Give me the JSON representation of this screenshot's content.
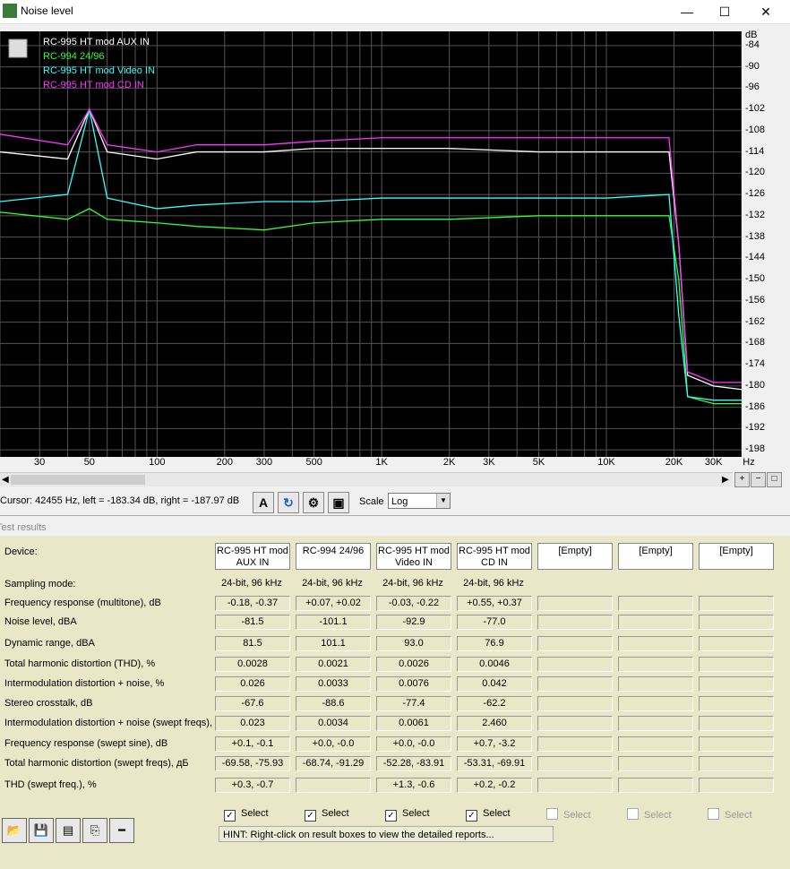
{
  "window": {
    "title": "Noise level",
    "minimize": "—",
    "maximize": "☐",
    "close": "✕"
  },
  "legend": [
    {
      "name": "RC-995 HT mod AUX IN",
      "color": "#ffffff"
    },
    {
      "name": "RC-994 24/96",
      "color": "#33ff33"
    },
    {
      "name": "RC-995 HT mod Video IN",
      "color": "#33ffff"
    },
    {
      "name": "RC-995 HT mod CD IN",
      "color": "#ff33ff"
    }
  ],
  "chart_data": {
    "type": "line",
    "xscale": "log",
    "xlim": [
      20,
      40000
    ],
    "ylim": [
      -200,
      -80
    ],
    "ylabel": "dB",
    "xlabel": "Hz",
    "x_ticks": [
      "30",
      "50",
      "100",
      "200",
      "300",
      "500",
      "1K",
      "2K",
      "3K",
      "5K",
      "10K",
      "20K",
      "30K"
    ],
    "y_ticks": [
      "-84",
      "-90",
      "-96",
      "-102",
      "-108",
      "-114",
      "-120",
      "-126",
      "-132",
      "-138",
      "-144",
      "-150",
      "-156",
      "-162",
      "-168",
      "-174",
      "-180",
      "-186",
      "-192",
      "-198"
    ],
    "grid": true,
    "series": [
      {
        "name": "RC-995 HT mod AUX IN",
        "color": "#ffffff",
        "x": [
          20,
          40,
          50,
          60,
          100,
          150,
          300,
          500,
          1000,
          2000,
          5000,
          10000,
          19000,
          21000,
          23000,
          30000,
          40000
        ],
        "y": [
          -114,
          -116,
          -102,
          -114,
          -116,
          -114,
          -114,
          -113,
          -113,
          -113,
          -114,
          -114,
          -114,
          -140,
          -177,
          -180,
          -181
        ]
      },
      {
        "name": "RC-994 24/96",
        "color": "#33ff33",
        "x": [
          20,
          40,
          50,
          60,
          100,
          150,
          300,
          500,
          1000,
          2000,
          5000,
          10000,
          19000,
          21000,
          23000,
          30000,
          40000
        ],
        "y": [
          -131,
          -133,
          -130,
          -133,
          -134,
          -135,
          -136,
          -134,
          -133,
          -133,
          -132,
          -132,
          -132,
          -150,
          -183,
          -185,
          -185
        ]
      },
      {
        "name": "RC-995 HT mod Video IN",
        "color": "#33ffff",
        "x": [
          20,
          40,
          50,
          60,
          100,
          150,
          300,
          500,
          1000,
          2000,
          5000,
          10000,
          19000,
          21000,
          23000,
          30000,
          40000
        ],
        "y": [
          -128,
          -126,
          -102,
          -127,
          -130,
          -129,
          -128,
          -128,
          -127,
          -127,
          -127,
          -127,
          -126,
          -160,
          -183,
          -184,
          -184
        ]
      },
      {
        "name": "RC-995 HT mod CD IN",
        "color": "#ff33ff",
        "x": [
          20,
          40,
          50,
          60,
          100,
          150,
          300,
          500,
          1000,
          2000,
          5000,
          10000,
          19000,
          21000,
          23000,
          30000,
          40000
        ],
        "y": [
          -109,
          -112,
          -102,
          -112,
          -114,
          -112,
          -112,
          -111,
          -110,
          -110,
          -110,
          -110,
          -110,
          -140,
          -176,
          -179,
          -179
        ]
      }
    ]
  },
  "toolbar": {
    "cursor": "Cursor:  42455 Hz,  left = -183.34 dB,  right = -187.97 dB",
    "scale_label": "Scale",
    "scale_value": "Log"
  },
  "results_title": "Test results",
  "device_label": "Device:",
  "devices": [
    "RC-995 HT mod AUX IN",
    "RC-994 24/96",
    "RC-995 HT mod Video IN",
    "RC-995 HT mod CD IN",
    "[Empty]",
    "[Empty]",
    "[Empty]"
  ],
  "rows": [
    {
      "label": "Sampling mode:",
      "values": [
        "24-bit, 96 kHz",
        "24-bit, 96 kHz",
        "24-bit, 96 kHz",
        "24-bit, 96 kHz"
      ]
    },
    {
      "label": "Frequency response (multitone), dB",
      "values": [
        "-0.18, -0.37",
        "+0.07, +0.02",
        "-0.03, -0.22",
        "+0.55, +0.37"
      ]
    },
    {
      "label": "Noise level, dBA",
      "values": [
        "-81.5",
        "-101.1",
        "-92.9",
        "-77.0"
      ]
    },
    {
      "label": "Dynamic range, dBA",
      "values": [
        "81.5",
        "101.1",
        "93.0",
        "76.9"
      ]
    },
    {
      "label": "Total harmonic distortion (THD), %",
      "values": [
        "0.0028",
        "0.0021",
        "0.0026",
        "0.0046"
      ]
    },
    {
      "label": "Intermodulation distortion + noise, %",
      "values": [
        "0.026",
        "0.0033",
        "0.0076",
        "0.042"
      ]
    },
    {
      "label": "Stereo crosstalk, dB",
      "values": [
        "-67.6",
        "-88.6",
        "-77.4",
        "-62.2"
      ]
    },
    {
      "label": "Intermodulation distortion + noise (swept freqs), %",
      "values": [
        "0.023",
        "0.0034",
        "0.0061",
        "2.460"
      ]
    },
    {
      "label": "Frequency response (swept sine), dB",
      "values": [
        "+0.1, -0.1",
        "+0.0, -0.0",
        "+0.0, -0.0",
        "+0.7, -3.2"
      ]
    },
    {
      "label": "Total harmonic distortion (swept freqs), дБ",
      "values": [
        "-69.58, -75.93",
        "-68.74, -91.29",
        "-52.28, -83.91",
        "-53.31, -69.91"
      ]
    },
    {
      "label": "THD (swept freq.), %",
      "values": [
        "+0.3, -0.7",
        "",
        "+1.3, -0.6",
        "+0.2, -0.2"
      ]
    }
  ],
  "select_label": "Select",
  "hint": "HINT: Right-click on result boxes to view the detailed reports..."
}
